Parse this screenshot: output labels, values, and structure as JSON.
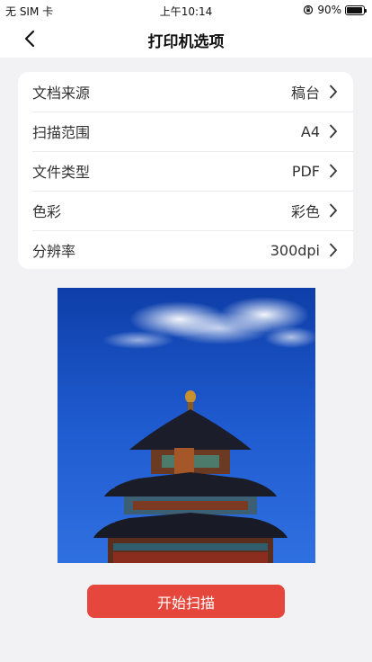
{
  "status_bar": {
    "carrier": "无 SIM 卡",
    "time": "上午10:14",
    "battery": "90%",
    "battery_level": 0.9
  },
  "nav": {
    "back_icon": "chevron-left-icon",
    "title": "打印机选项"
  },
  "options": [
    {
      "label": "文档来源",
      "value": "稿台"
    },
    {
      "label": "扫描范围",
      "value": "A4"
    },
    {
      "label": "文件类型",
      "value": "PDF"
    },
    {
      "label": "色彩",
      "value": "彩色"
    },
    {
      "label": "分辨率",
      "value": "300dpi"
    }
  ],
  "preview": {
    "image": "temple-of-heaven-photo"
  },
  "action": {
    "scan_label": "开始扫描",
    "color": "#e5473c"
  },
  "colors": {
    "background": "#f2f2f4",
    "card": "#ffffff",
    "accent": "#e5473c"
  }
}
